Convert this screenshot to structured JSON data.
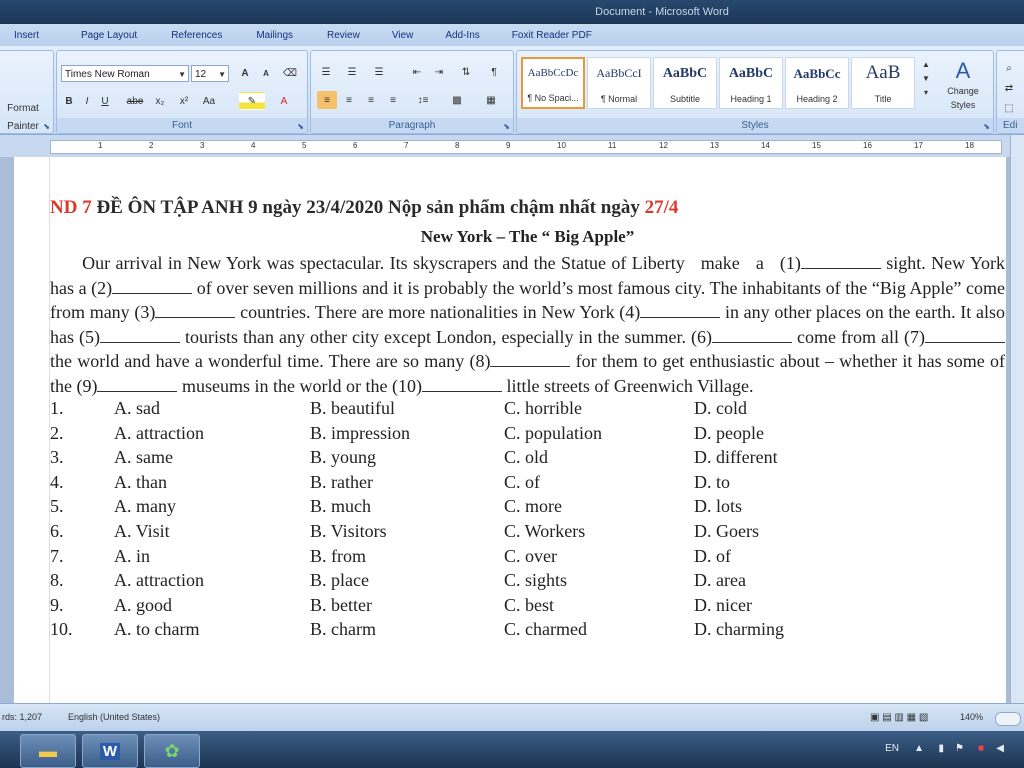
{
  "window": {
    "title": "Document - Microsoft Word"
  },
  "ribbon": {
    "tabs": [
      "Insert",
      "Page Layout",
      "References",
      "Mailings",
      "Review",
      "View",
      "Add-Ins",
      "Foxit Reader PDF"
    ],
    "clipboard": {
      "format_painter": "Format Painter"
    },
    "font": {
      "group_label": "Font",
      "name": "Times New Roman",
      "size": "12",
      "bold": "B",
      "italic": "I",
      "underline": "U",
      "strike": "abe",
      "subscript": "x₂",
      "superscript": "x²",
      "change_case": "Aa",
      "grow": "A",
      "shrink": "A"
    },
    "paragraph": {
      "group_label": "Paragraph"
    },
    "styles": {
      "group_label": "Styles",
      "items": [
        {
          "sample": "AaBbCcDc",
          "name": "¶ No Spaci..."
        },
        {
          "sample": "AaBbCcI",
          "name": "¶ Normal"
        },
        {
          "sample": "AaBbC",
          "name": "Subtitle"
        },
        {
          "sample": "AaBbC",
          "name": "Heading 1"
        },
        {
          "sample": "AaBbCc",
          "name": "Heading 2"
        },
        {
          "sample": "AaB",
          "name": "Title"
        }
      ],
      "change_styles": "Change Styles"
    },
    "editing": {
      "group_label": "Edi"
    }
  },
  "ruler": {
    "ticks": [
      "1",
      "2",
      "3",
      "4",
      "5",
      "6",
      "7",
      "8",
      "9",
      "10",
      "11",
      "12",
      "13",
      "14",
      "15",
      "16",
      "17",
      "18"
    ]
  },
  "document": {
    "heading_prefix": "ND 7",
    "heading_main": " ĐỀ ÔN TẬP ANH 9  ngày 23/4/2020 Nộp sản phẩm chậm nhất ngày ",
    "heading_date": "27/4",
    "subtitle": "New York – The “ Big Apple”",
    "passage": [
      "      Our arrival in New York was spectacular. Its skyscrapers and the Statue of Liberty   make   a   (1)",
      " sight. New York has a (2)",
      " of over seven millions and it is probably the world’s most famous city. The inhabitants of the “Big Apple” come from many (3)",
      " countries. There are more nationalities in New York (4)",
      " in any other places on the earth. It also has (5)",
      " tourists than any other city except London, especially in the summer. (6)",
      " come from all (7)",
      " the world and have a wonderful time. There are so many (8)",
      " for them to get enthusiastic about – whether it has some of the (9)",
      " museums in the world or the (10)",
      " little streets of Greenwich Village."
    ],
    "questions": [
      {
        "num": "1.",
        "a": "A. sad",
        "b": "B. beautiful",
        "c": "C. horrible",
        "d": "D. cold"
      },
      {
        "num": "2.",
        "a": "A. attraction",
        "b": "B. impression",
        "c": "C. population",
        "d": "D. people"
      },
      {
        "num": "3.",
        "a": "A. same",
        "b": "B. young",
        "c": "C. old",
        "d": "D. different"
      },
      {
        "num": "4.",
        "a": "A. than",
        "b": "B. rather",
        "c": "C. of",
        "d": "D. to"
      },
      {
        "num": "5.",
        "a": "A. many",
        "b": "B. much",
        "c": "C. more",
        "d": "D. lots"
      },
      {
        "num": "6.",
        "a": "A. Visit",
        "b": "B. Visitors",
        "c": "C. Workers",
        "d": "D. Goers"
      },
      {
        "num": "7.",
        "a": "A. in",
        "b": "B. from",
        "c": "C. over",
        "d": "D. of"
      },
      {
        "num": "8.",
        "a": "A. attraction",
        "b": "B. place",
        "c": "C. sights",
        "d": "D. area"
      },
      {
        "num": "9.",
        "a": "A. good",
        "b": "B. better",
        "c": "C. best",
        "d": "D. nicer"
      },
      {
        "num": "10.",
        "a": "A. to charm",
        "b": "B. charm",
        "c": "C. charmed",
        "d": "D. charming"
      }
    ]
  },
  "status": {
    "words": "rds: 1,207",
    "language": "English (United States)",
    "zoom": "140%"
  },
  "taskbar": {
    "lang": "EN"
  },
  "colors": {
    "accent_red": "#d93a2b",
    "ribbon": "#cfe0f5"
  }
}
